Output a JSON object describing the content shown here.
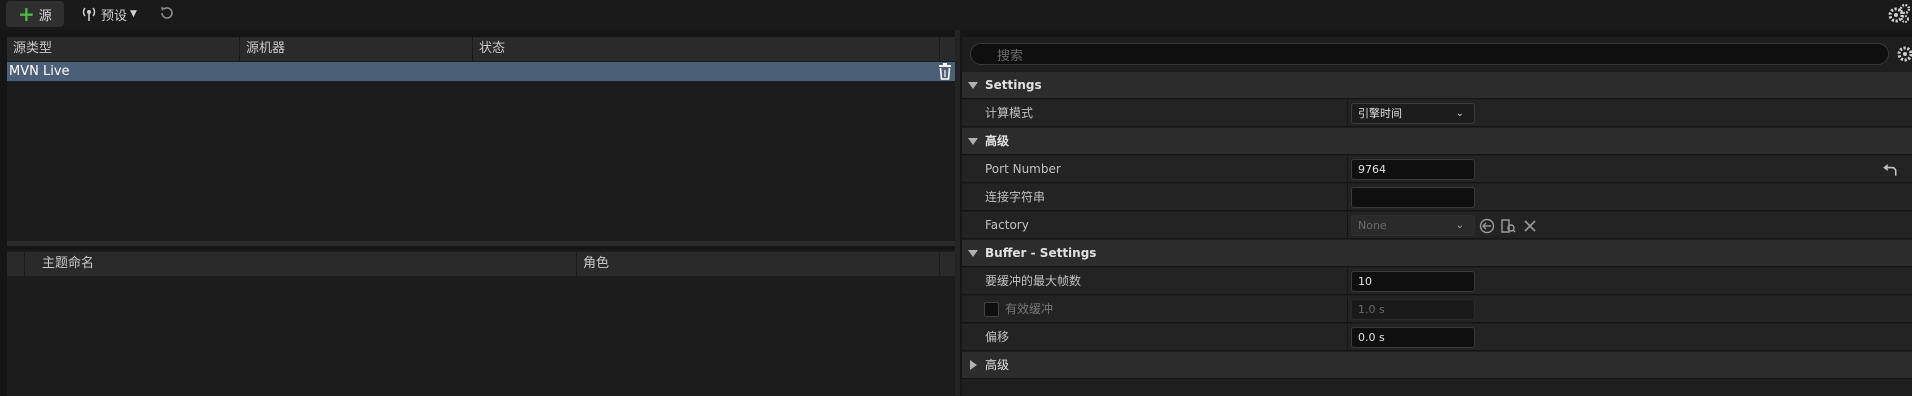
{
  "toolbar": {
    "add_source_label": "源",
    "presets_label": "预设"
  },
  "sources": {
    "columns": [
      "源类型",
      "源机器",
      "状态"
    ],
    "rows": [
      {
        "type": "MVN Live",
        "machine": "",
        "status": ""
      }
    ]
  },
  "subjects": {
    "columns": [
      "主题命名",
      "角色"
    ]
  },
  "details": {
    "search_placeholder": "搜索",
    "settings_category": "Settings",
    "evaluation_mode_label": "计算模式",
    "evaluation_mode_value": "引擎时间",
    "advanced_category": "高级",
    "port_number_label": "Port Number",
    "port_number_value": "9764",
    "connection_string_label": "连接字符串",
    "connection_string_value": "",
    "factory_label": "Factory",
    "factory_value": "None",
    "buffer_category": "Buffer - Settings",
    "max_frames_label": "要缓冲的最大帧数",
    "max_frames_value": "10",
    "valid_buffer_label": "有效缓冲",
    "valid_buffer_value": "1.0 s",
    "offset_label": "偏移",
    "offset_value": "0.0 s",
    "advanced2_category": "高级"
  },
  "colors": {
    "selection": "#4b5f77",
    "accent_green": "#4fb84a",
    "background": "#151515"
  }
}
